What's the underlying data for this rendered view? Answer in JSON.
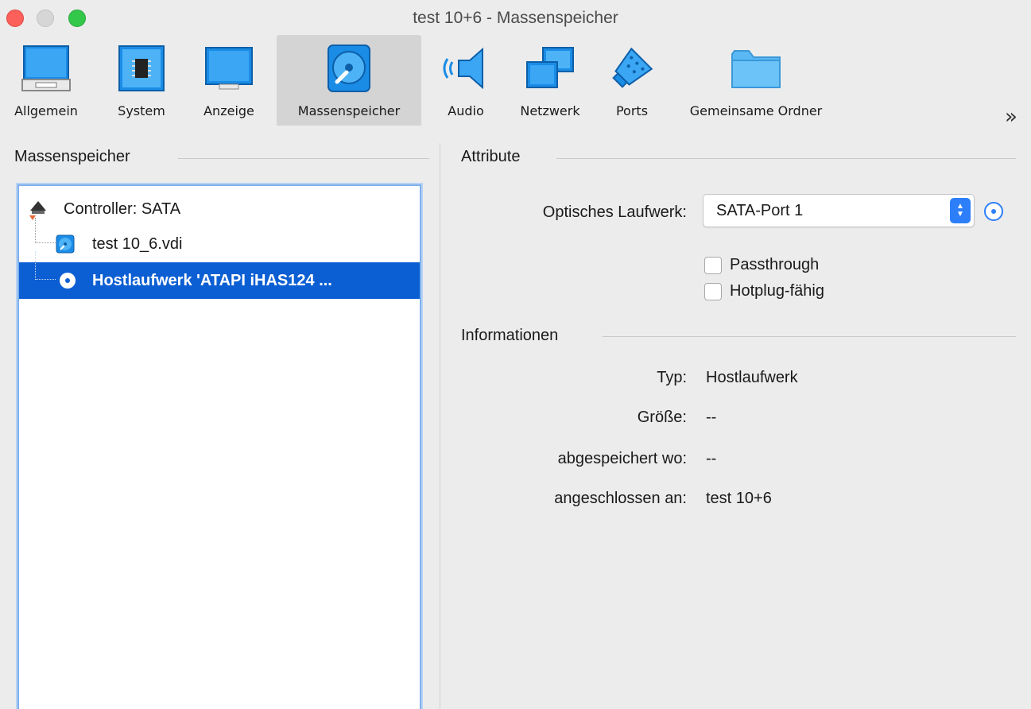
{
  "window": {
    "title": "test 10+6 - Massenspeicher"
  },
  "toolbar": {
    "items": [
      {
        "label": "Allgemein",
        "icon": "general-icon"
      },
      {
        "label": "System",
        "icon": "chip-icon"
      },
      {
        "label": "Anzeige",
        "icon": "display-icon"
      },
      {
        "label": "Massenspeicher",
        "icon": "hard-disk-icon",
        "selected": true
      },
      {
        "label": "Audio",
        "icon": "speaker-icon"
      },
      {
        "label": "Netzwerk",
        "icon": "network-icon"
      },
      {
        "label": "Ports",
        "icon": "port-icon"
      },
      {
        "label": "Gemeinsame Ordner",
        "icon": "folder-icon"
      }
    ],
    "more": "»"
  },
  "storage": {
    "header": "Massenspeicher",
    "tree": [
      {
        "label": "Controller: SATA",
        "icon": "controller-icon"
      },
      {
        "label": "test 10_6.vdi",
        "icon": "hard-disk-icon"
      },
      {
        "label": "Hostlaufwerk 'ATAPI iHAS124  ...",
        "icon": "optical-disc-icon",
        "selected": true
      }
    ]
  },
  "attributes": {
    "header": "Attribute",
    "drive_label": "Optisches Laufwerk:",
    "drive_value": "SATA-Port 1",
    "passthrough": "Passthrough",
    "hotplug": "Hotplug-fähig"
  },
  "information": {
    "header": "Informationen",
    "rows": [
      {
        "key": "Typ:",
        "value": "Hostlaufwerk"
      },
      {
        "key": "Größe:",
        "value": "--"
      },
      {
        "key": "abgespeichert wo:",
        "value": "--"
      },
      {
        "key": "angeschlossen an:",
        "value": "test 10+6"
      }
    ]
  },
  "colors": {
    "accent": "#0b5fd3",
    "select_accent": "#2d7ff9"
  }
}
